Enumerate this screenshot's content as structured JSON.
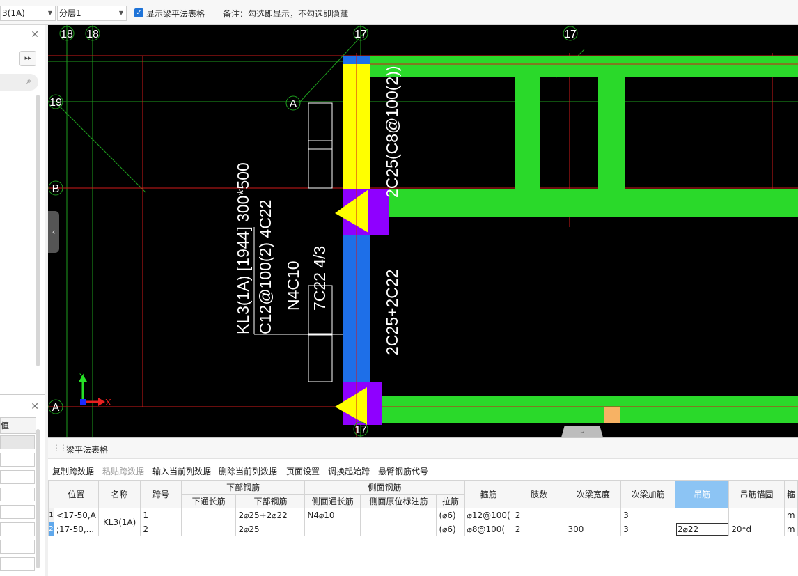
{
  "toolbar": {
    "beam_select_value": "KL3(1A)",
    "beam_select_visible": "3(1A)",
    "layer_select_value": "分层1",
    "show_table_checkbox_label": "显示梁平法表格",
    "show_table_checked": true,
    "note": "备注：勾选即显示，不勾选即隐藏"
  },
  "left_panel": {
    "header_visible_text": "值"
  },
  "canvas": {
    "axis_labels": {
      "top_left_1": "18",
      "top_left_2": "18",
      "top_mid": "17",
      "top_right": "17",
      "left_19": "19",
      "left_B": "B",
      "left_A": "A",
      "mid_A": "A",
      "bottom_17": "17"
    },
    "beam_annotation": {
      "line1": "KL3(1A) [1944] 300*500",
      "line2": "C12@100(2) 4C22",
      "line3": "N4C10",
      "line4": "7C22 4/3"
    },
    "rebar_top_label": "2C25(C8@100(2))",
    "rebar_bottom_label": "2C25+2C22",
    "ucs": {
      "y": "Y",
      "x": "X"
    }
  },
  "bottom_panel": {
    "title": "梁平法表格",
    "tools": [
      "复制跨数据",
      "粘贴跨数据",
      "输入当前列数据",
      "删除当前列数据",
      "页面设置",
      "调换起始跨",
      "悬臂钢筋代号"
    ],
    "disabled_tools": [
      "粘贴跨数据"
    ],
    "groups": {
      "bottom_rebar": "下部钢筋",
      "side_rebar": "侧面钢筋"
    },
    "columns": {
      "position": "位置",
      "name": "名称",
      "span": "跨号",
      "bottom_through": "下通长筋",
      "bottom_rebar": "下部钢筋",
      "side_through": "侧面通长筋",
      "side_original": "侧面原位标注筋",
      "tie": "拉筋",
      "stirrup": "箍筋",
      "legs": "肢数",
      "sec_beam_width": "次梁宽度",
      "sec_beam_add": "次梁加筋",
      "hanger": "吊筋",
      "hanger_anchor": "吊筋锚固",
      "cut": "箍"
    },
    "rows": [
      {
        "num": "1",
        "position": "<17-50,A",
        "span": "1",
        "bottom_through": "",
        "bottom_rebar": "2⌀25+2⌀22",
        "side_through": "N4⌀10",
        "side_original": "",
        "tie": "(⌀6)",
        "stirrup": "⌀12@100(",
        "legs": "2",
        "sec_beam_width": "",
        "sec_beam_add": "3",
        "hanger": "",
        "hanger_anchor": "",
        "cut": "m"
      },
      {
        "num": "2",
        "position": ";17-50,...",
        "span": "2",
        "bottom_through": "",
        "bottom_rebar": "2⌀25",
        "side_through": "",
        "side_original": "",
        "tie": "(⌀6)",
        "stirrup": "⌀8@100(",
        "legs": "2",
        "sec_beam_width": "300",
        "sec_beam_add": "3",
        "hanger": "2⌀22",
        "hanger_anchor": "20*d",
        "cut": "m"
      }
    ],
    "merged_name": "KL3(1A)"
  },
  "colors": {
    "green_beam": "#2ad92a",
    "yellow_beam": "#ffff00",
    "blue_beam": "#1e6fe8",
    "purple_support": "#8f00ff",
    "red_axis": "#d11a1a",
    "grid_green": "#1e9e1e",
    "orange_mark": "#f7b264",
    "header_highlight": "#8cc4f4"
  }
}
